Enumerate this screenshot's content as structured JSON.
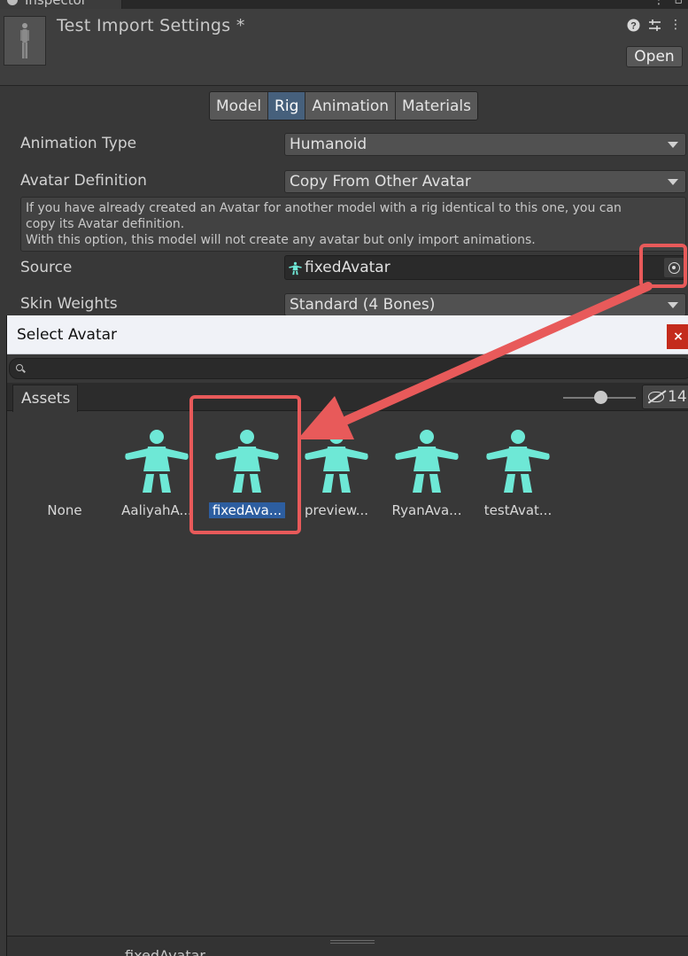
{
  "inspector": {
    "tab_label": "Inspector",
    "title": "Test Import Settings *",
    "open_label": "Open",
    "tabs": [
      "Model",
      "Rig",
      "Animation",
      "Materials"
    ],
    "active_tab": "Rig",
    "fields": {
      "animation_type_label": "Animation Type",
      "animation_type_value": "Humanoid",
      "avatar_definition_label": "Avatar Definition",
      "avatar_definition_value": "Copy From Other Avatar",
      "help_line1": "If you have already created an Avatar for another model with a rig identical to this one, you can",
      "help_line2": "copy its Avatar definition.",
      "help_line3": "With this option, this model will not create any avatar but only import animations.",
      "source_label": "Source",
      "source_value": "fixedAvatar",
      "skin_weights_label": "Skin Weights",
      "skin_weights_value": "Standard (4 Bones)"
    }
  },
  "select_avatar": {
    "title": "Select Avatar",
    "close_glyph": "×",
    "assets_tab": "Assets",
    "hidden_count": "14",
    "items": [
      {
        "label": "None",
        "icon": "none"
      },
      {
        "label": "AaliyahA...",
        "icon": "avatar-icon"
      },
      {
        "label": "fixedAva...",
        "icon": "avatar-icon",
        "selected": true
      },
      {
        "label": "preview...",
        "icon": "avatar-icon"
      },
      {
        "label": "RyanAva...",
        "icon": "avatar-icon"
      },
      {
        "label": "testAvat...",
        "icon": "avatar-icon"
      }
    ],
    "bottom_label": "fixedAvatar"
  },
  "colors": {
    "avatar_icon": "#6ee8d6",
    "selected_highlight": "#2d5ea0",
    "annotation_red": "#e85a5a",
    "active_tab": "#46607c"
  }
}
